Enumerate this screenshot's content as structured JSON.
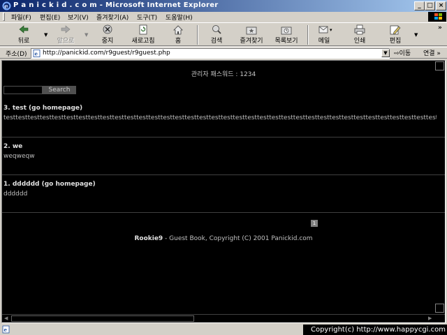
{
  "window": {
    "title": "P a n i c k i d . c o m - Microsoft Internet Explorer",
    "min": "_",
    "max": "□",
    "close": "×"
  },
  "menu": [
    {
      "label": "파일(F)"
    },
    {
      "label": "편집(E)"
    },
    {
      "label": "보기(V)"
    },
    {
      "label": "즐겨찾기(A)"
    },
    {
      "label": "도구(T)"
    },
    {
      "label": "도움말(H)"
    }
  ],
  "toolbar": {
    "back": "뒤로",
    "forward": "앞으로",
    "stop": "중지",
    "refresh": "새로고침",
    "home": "홈",
    "search": "검색",
    "favorites": "즐겨찾기",
    "history": "목록보기",
    "mail": "메일",
    "print": "인쇄",
    "edit": "편집",
    "chevron": "»"
  },
  "address": {
    "label": "주소(D)",
    "url": "http://panickid.com/r9guest/r9guest.php",
    "go": "이동",
    "links": "연결 »"
  },
  "page": {
    "admin_password": "관리자 패스워드 : 1234",
    "search_button": "Search",
    "entries": [
      {
        "title": "3. test (go homepage)",
        "body": "testtesttesttesttesttesttesttesttesttesttesttesttesttesttesttesttesttesttesttesttesttesttesttesttesttesttesttesttesttesttesttesttesttesttesttesttest"
      },
      {
        "title": "2. we",
        "body": "weqweqw"
      },
      {
        "title": "1. dddddd (go homepage)",
        "body": "dddddd"
      }
    ],
    "page_number": "1",
    "footer_brand": "Rookie9",
    "footer_text": " - Guest Book, Copyright (C) 2001 Panickid.com"
  },
  "status": {
    "copyright": "Copyright(c) http://www.happycgi.com"
  },
  "colors": {
    "title_start": "#0a246a",
    "title_end": "#a6caf0",
    "chrome": "#d4d0c8",
    "content_bg": "#000000"
  }
}
